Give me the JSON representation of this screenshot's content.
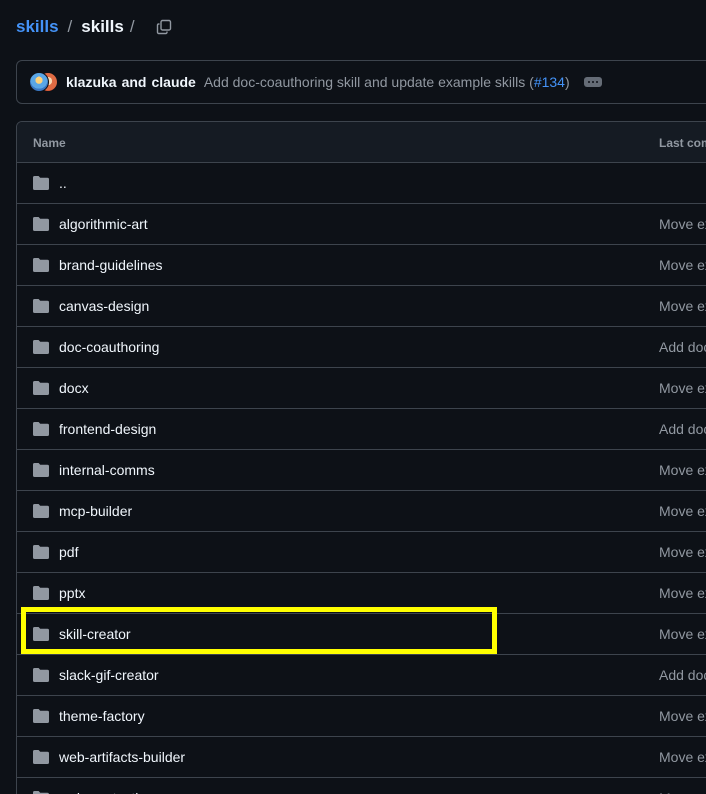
{
  "breadcrumb": {
    "repo": "skills",
    "separator": "/",
    "current": "skills",
    "trailing_separator": "/"
  },
  "commit": {
    "author1": "klazuka",
    "and": "and",
    "author2": "claude",
    "message_prefix": "Add doc-coauthoring skill and update example skills (",
    "pr": "#134",
    "message_suffix": ")"
  },
  "table": {
    "header_name": "Name",
    "header_last_commit": "Last commit message",
    "rows": [
      {
        "name": "..",
        "message": ""
      },
      {
        "name": "algorithmic-art",
        "message": "Move example skills into dedicated folder"
      },
      {
        "name": "brand-guidelines",
        "message": "Move example skills into dedicated folder"
      },
      {
        "name": "canvas-design",
        "message": "Move example skills into dedicated folder"
      },
      {
        "name": "doc-coauthoring",
        "message": "Add doc-coauthoring skill and update example skills"
      },
      {
        "name": "docx",
        "message": "Move example skills into dedicated folder"
      },
      {
        "name": "frontend-design",
        "message": "Add doc-coauthoring skill and update example skills"
      },
      {
        "name": "internal-comms",
        "message": "Move example skills into dedicated folder"
      },
      {
        "name": "mcp-builder",
        "message": "Move example skills into dedicated folder"
      },
      {
        "name": "pdf",
        "message": "Move example skills into dedicated folder"
      },
      {
        "name": "pptx",
        "message": "Move example skills into dedicated folder"
      },
      {
        "name": "skill-creator",
        "message": "Move example skills into dedicated folder"
      },
      {
        "name": "slack-gif-creator",
        "message": "Add doc-coauthoring skill and update example skills"
      },
      {
        "name": "theme-factory",
        "message": "Move example skills into dedicated folder"
      },
      {
        "name": "web-artifacts-builder",
        "message": "Move example skills into dedicated folder"
      },
      {
        "name": "webapp-testing",
        "message": "Move example skills into dedicated folder"
      }
    ]
  },
  "highlighted_row": "skill-creator",
  "colors": {
    "background": "#0d1117",
    "link": "#4493f8",
    "border": "#3d444d",
    "muted": "#9198a1",
    "highlight": "#ffff00"
  },
  "icons": {
    "copy": "copy-icon",
    "folder": "folder-icon",
    "ellipsis": "ellipsis-icon"
  }
}
